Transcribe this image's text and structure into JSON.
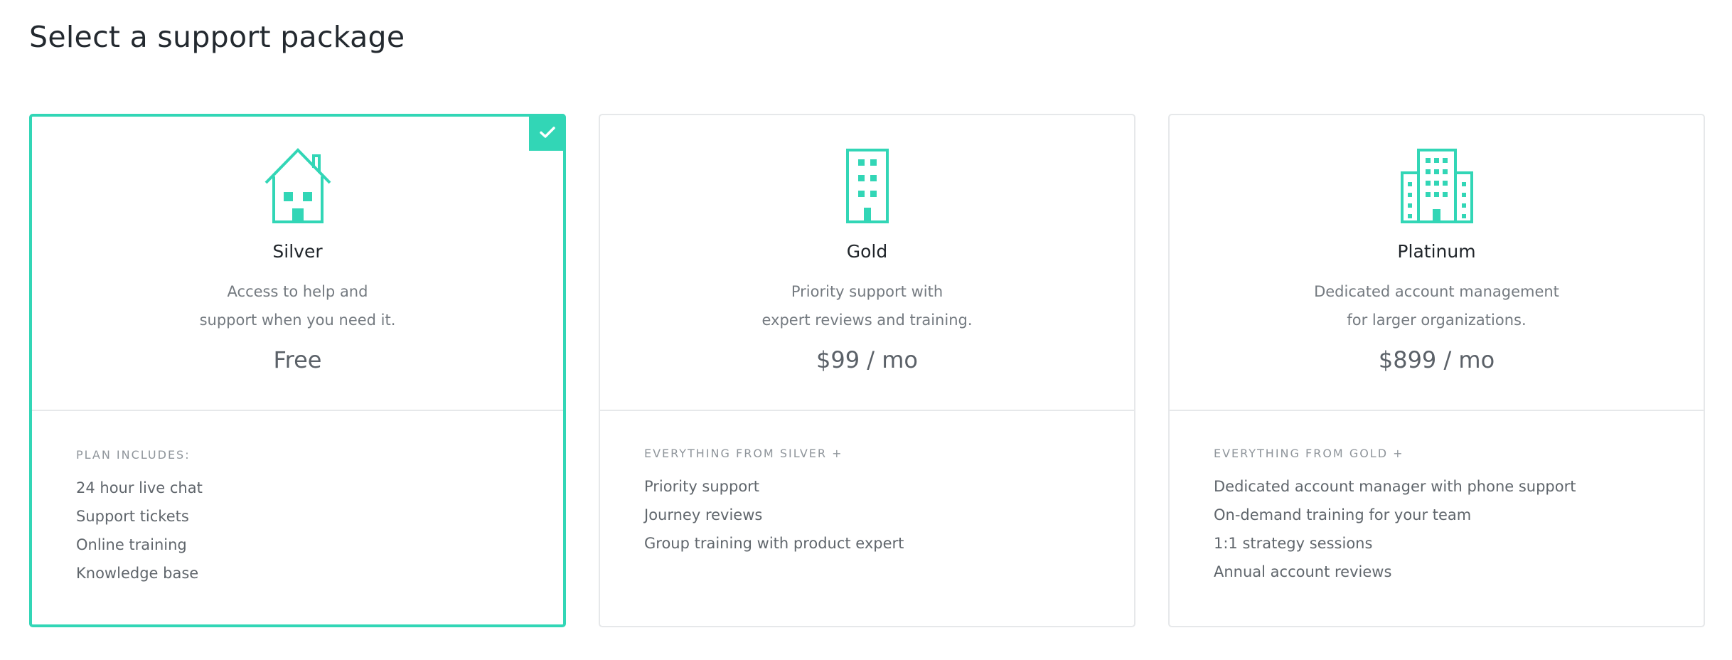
{
  "page": {
    "title": "Select a support package"
  },
  "colors": {
    "accent": "#32d6b6",
    "border": "#e6e8ea",
    "heading": "#23292f",
    "muted_text": "#747a80"
  },
  "plans": [
    {
      "name": "Silver",
      "icon": "house-icon",
      "selected": true,
      "description_lines": [
        "Access to help and",
        "support when you need it."
      ],
      "price": "Free",
      "features_heading": "PLAN INCLUDES:",
      "features": [
        "24 hour live chat",
        "Support tickets",
        "Online training",
        "Knowledge base"
      ]
    },
    {
      "name": "Gold",
      "icon": "building-icon",
      "selected": false,
      "description_lines": [
        "Priority support with",
        "expert reviews and training."
      ],
      "price": "$99 / mo",
      "features_heading": "EVERYTHING FROM SILVER +",
      "features": [
        "Priority support",
        "Journey reviews",
        "Group training with product expert"
      ]
    },
    {
      "name": "Platinum",
      "icon": "office-buildings-icon",
      "selected": false,
      "description_lines": [
        "Dedicated account management",
        "for larger organizations."
      ],
      "price": "$899 / mo",
      "features_heading": "EVERYTHING FROM GOLD +",
      "features": [
        "Dedicated account manager with phone support",
        "On-demand training for your team",
        "1:1 strategy sessions",
        "Annual account reviews"
      ]
    }
  ]
}
